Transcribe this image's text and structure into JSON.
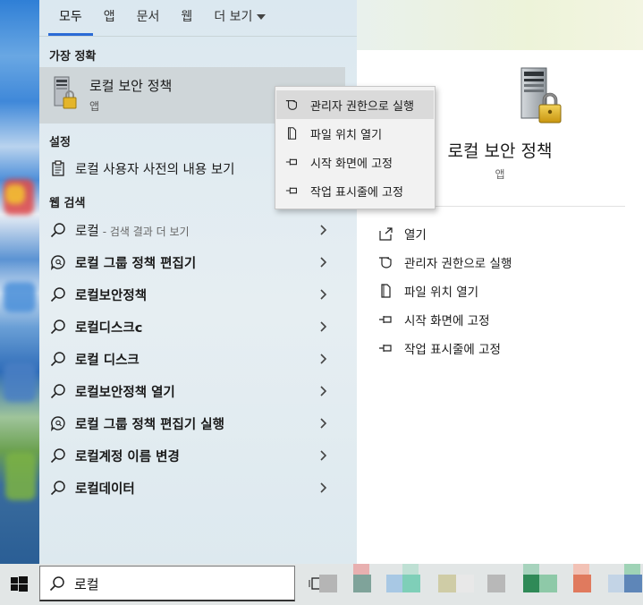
{
  "tabs": [
    {
      "label": "모두"
    },
    {
      "label": "앱"
    },
    {
      "label": "문서"
    },
    {
      "label": "웹"
    },
    {
      "label": "더 보기"
    }
  ],
  "best_match": {
    "heading": "가장 정확",
    "title": "로컬 보안 정책",
    "type": "앱"
  },
  "settings": {
    "heading": "설정",
    "item": "로컬 사용자 사전의 내용 보기"
  },
  "web": {
    "heading": "웹 검색",
    "items": [
      {
        "label": "로컬",
        "sub": "- 검색 결과 더 보기",
        "icon": "search-icon"
      },
      {
        "label": "로컬 그룹 정책 편집기",
        "icon": "chat-search-icon"
      },
      {
        "label": "로컬보안정책",
        "icon": "search-icon"
      },
      {
        "label": "로컬디스크c",
        "icon": "search-icon"
      },
      {
        "label": "로컬 디스크",
        "icon": "search-icon"
      },
      {
        "label": "로컬보안정책 열기",
        "icon": "search-icon"
      },
      {
        "label": "로컬 그룹 정책 편집기 실행",
        "icon": "chat-search-icon"
      },
      {
        "label": "로컬계정 이름 변경",
        "icon": "search-icon"
      },
      {
        "label": "로컬데이터",
        "icon": "search-icon"
      }
    ]
  },
  "context_menu": [
    {
      "label": "관리자 권한으로 실행",
      "icon": "shield-icon"
    },
    {
      "label": "파일 위치 열기",
      "icon": "folder-icon"
    },
    {
      "label": "시작 화면에 고정",
      "icon": "pin-icon"
    },
    {
      "label": "작업 표시줄에 고정",
      "icon": "pin-icon"
    }
  ],
  "detail": {
    "title": "로컬 보안 정책",
    "type": "앱",
    "actions": [
      {
        "label": "열기",
        "icon": "open-icon"
      },
      {
        "label": "관리자 권한으로 실행",
        "icon": "shield-icon"
      },
      {
        "label": "파일 위치 열기",
        "icon": "folder-icon"
      },
      {
        "label": "시작 화면에 고정",
        "icon": "pin-icon"
      },
      {
        "label": "작업 표시줄에 고정",
        "icon": "pin-icon"
      }
    ]
  },
  "search": {
    "value": "로컬"
  },
  "colors": {
    "accent": "#2a6bd6",
    "selection": "#cfd6d9",
    "menu_hover": "#dadada"
  }
}
